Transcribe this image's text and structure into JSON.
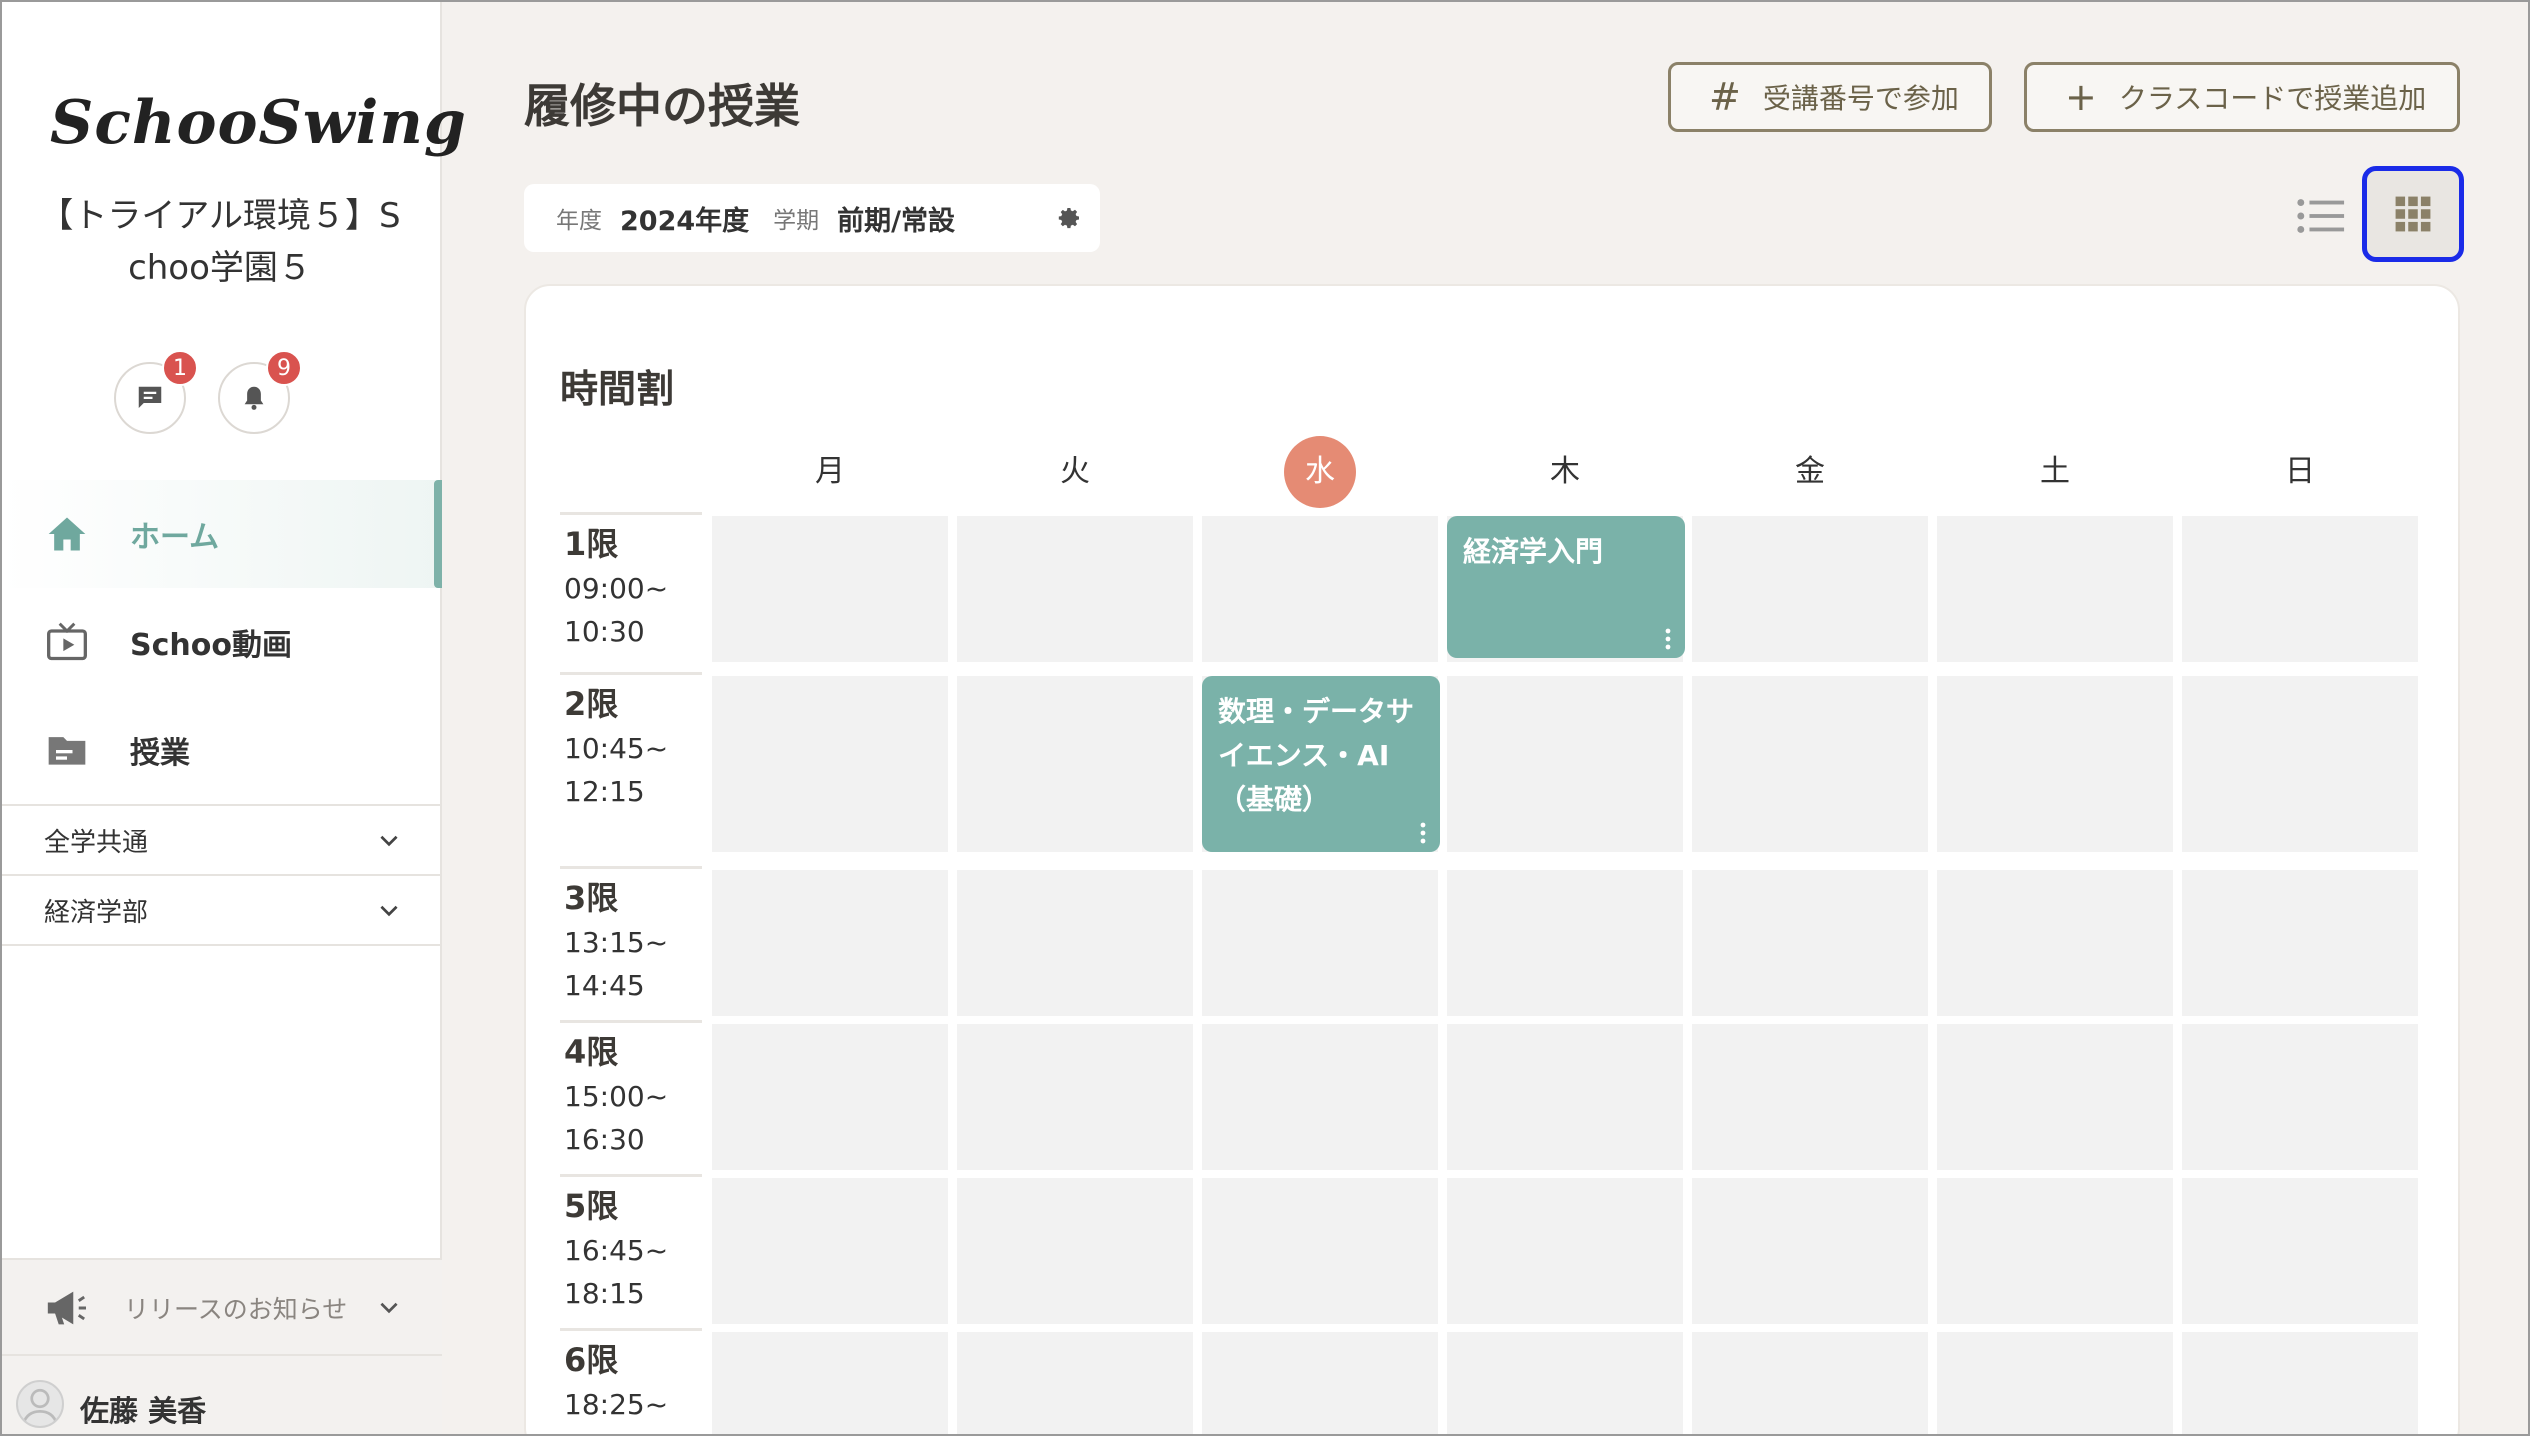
{
  "sidebar": {
    "logo": "SchooSwing",
    "org_name_line1": "【トライアル環境５】S",
    "org_name_line2": "choo学園５",
    "messages_badge": "1",
    "notifications_badge": "9",
    "nav": [
      {
        "label": "ホーム",
        "icon": "home-icon",
        "active": true
      },
      {
        "label": "Schoo動画",
        "icon": "tv-icon",
        "active": false
      },
      {
        "label": "授業",
        "icon": "folder-icon",
        "active": false
      }
    ],
    "sections": [
      {
        "label": "全学共通"
      },
      {
        "label": "経済学部"
      }
    ],
    "release_label": "リリースのお知らせ",
    "user_name": "佐藤 美香"
  },
  "header": {
    "title": "履修中の授業",
    "join_button": "受講番号で参加",
    "add_button": "クラスコードで授業追加"
  },
  "filter": {
    "year_label": "年度",
    "year_value": "2024年度",
    "term_label": "学期",
    "term_value": "前期/常設"
  },
  "timetable": {
    "title": "時間割",
    "days": [
      "月",
      "火",
      "水",
      "木",
      "金",
      "土",
      "日"
    ],
    "today_index": 2,
    "periods": [
      {
        "name": "1限",
        "start": "09:00~",
        "end": "10:30"
      },
      {
        "name": "2限",
        "start": "10:45~",
        "end": "12:15"
      },
      {
        "name": "3限",
        "start": "13:15~",
        "end": "14:45"
      },
      {
        "name": "4限",
        "start": "15:00~",
        "end": "16:30"
      },
      {
        "name": "5限",
        "start": "16:45~",
        "end": "18:15"
      },
      {
        "name": "6限",
        "start": "18:25~",
        "end": ""
      }
    ],
    "courses": [
      {
        "title": "経済学入門",
        "day": "木",
        "period": "1限"
      },
      {
        "title_line1": "数理・データサ",
        "title_line2": "イエンス・AI",
        "title_line3": "（基礎）",
        "day": "水",
        "period": "2限"
      }
    ]
  },
  "colors": {
    "accent_teal": "#7ab2a9",
    "today_circle": "#e58b74",
    "badge_red": "#d9534f",
    "button_border": "#8b8168",
    "focus_outline": "#1a2be8"
  }
}
